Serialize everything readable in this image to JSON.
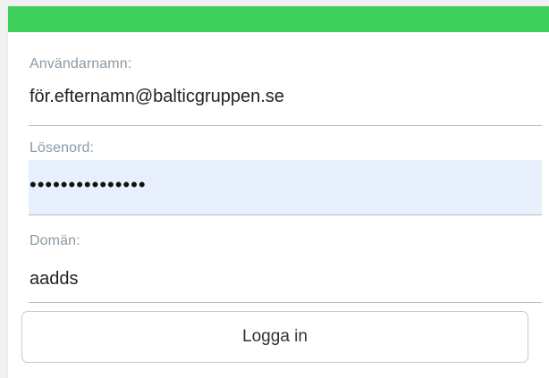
{
  "colors": {
    "accent_bar": "#3ecf5a",
    "autofill_background": "#e8f0fe",
    "label_text": "#8a9aa6"
  },
  "form": {
    "username": {
      "label": "Användarnamn:",
      "value": "för.efternamn@balticgruppen.se"
    },
    "password": {
      "label": "Lösenord:",
      "value": "•••••••••••••••"
    },
    "domain": {
      "label": "Domän:",
      "value": "aadds"
    },
    "submit_label": "Logga in"
  }
}
